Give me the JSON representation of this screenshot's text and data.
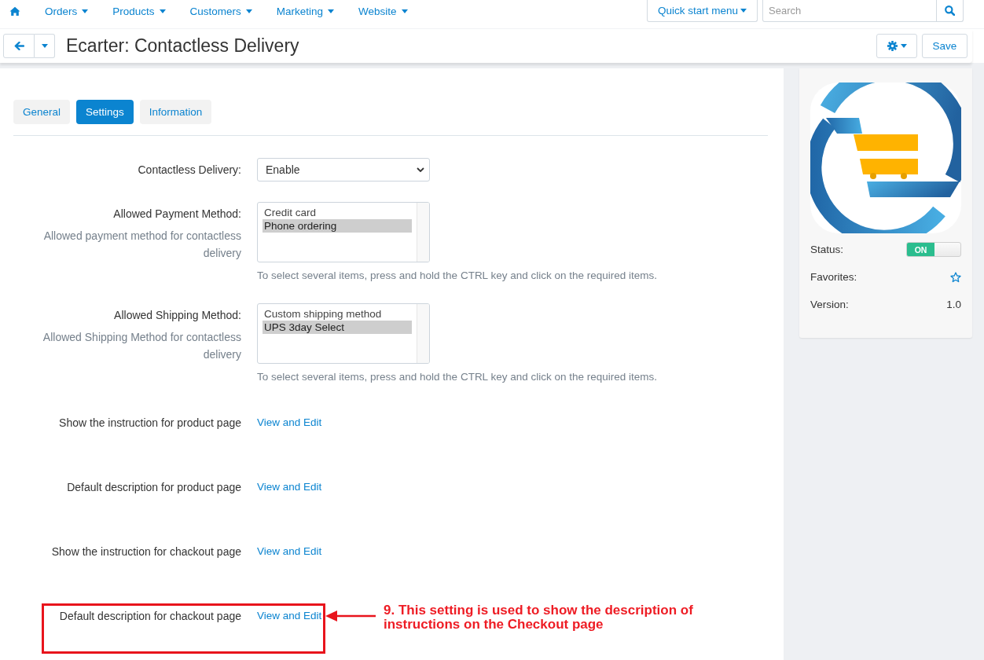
{
  "top_nav": {
    "items": [
      {
        "label": "Orders"
      },
      {
        "label": "Products"
      },
      {
        "label": "Customers"
      },
      {
        "label": "Marketing"
      },
      {
        "label": "Website"
      }
    ],
    "quick_start": "Quick start menu",
    "search": {
      "placeholder": "Search"
    }
  },
  "header": {
    "title": "Ecarter: Contactless Delivery",
    "save": "Save"
  },
  "tabs": [
    {
      "label": "General",
      "selected": false
    },
    {
      "label": "Settings",
      "selected": true
    },
    {
      "label": "Information",
      "selected": false
    }
  ],
  "settings": [
    {
      "kind": "select",
      "label": "Contactless Delivery:",
      "value": "Enable",
      "highlighted": false
    },
    {
      "kind": "multiselect",
      "label": "Allowed Payment Method:",
      "description": "Allowed payment method for contactless delivery",
      "options": [
        {
          "label": "Credit card",
          "selected": false
        },
        {
          "label": "Phone ordering",
          "selected": true
        }
      ],
      "hint": "To select several items, press and hold the CTRL key and click on the required items.",
      "highlighted": false
    },
    {
      "kind": "multiselect",
      "label": "Allowed Shipping Method:",
      "description": "Allowed Shipping Method for contactless delivery",
      "options": [
        {
          "label": "Custom shipping method",
          "selected": false
        },
        {
          "label": "UPS 3day Select",
          "selected": true
        }
      ],
      "hint": "To select several items, press and hold the CTRL key and click on the required items.",
      "highlighted": false
    },
    {
      "kind": "link",
      "label": "Show the instruction for product page",
      "link": "View and Edit",
      "highlighted": false
    },
    {
      "kind": "link",
      "label": "Default description for product page",
      "link": "View and Edit",
      "highlighted": false
    },
    {
      "kind": "link",
      "label": "Show the instruction for chackout page",
      "link": "View and Edit",
      "highlighted": false
    },
    {
      "kind": "link",
      "label": "Default description for chackout page",
      "link": "View and Edit",
      "highlighted": true
    }
  ],
  "callout": {
    "text": "9. This setting is used to show the description of instructions on the Checkout page"
  },
  "sidebar": {
    "status": {
      "label": "Status:",
      "toggle": "ON",
      "on": true
    },
    "favorites": {
      "label": "Favorites:",
      "starred": false
    },
    "version": {
      "label": "Version:",
      "value": "1.0"
    }
  }
}
